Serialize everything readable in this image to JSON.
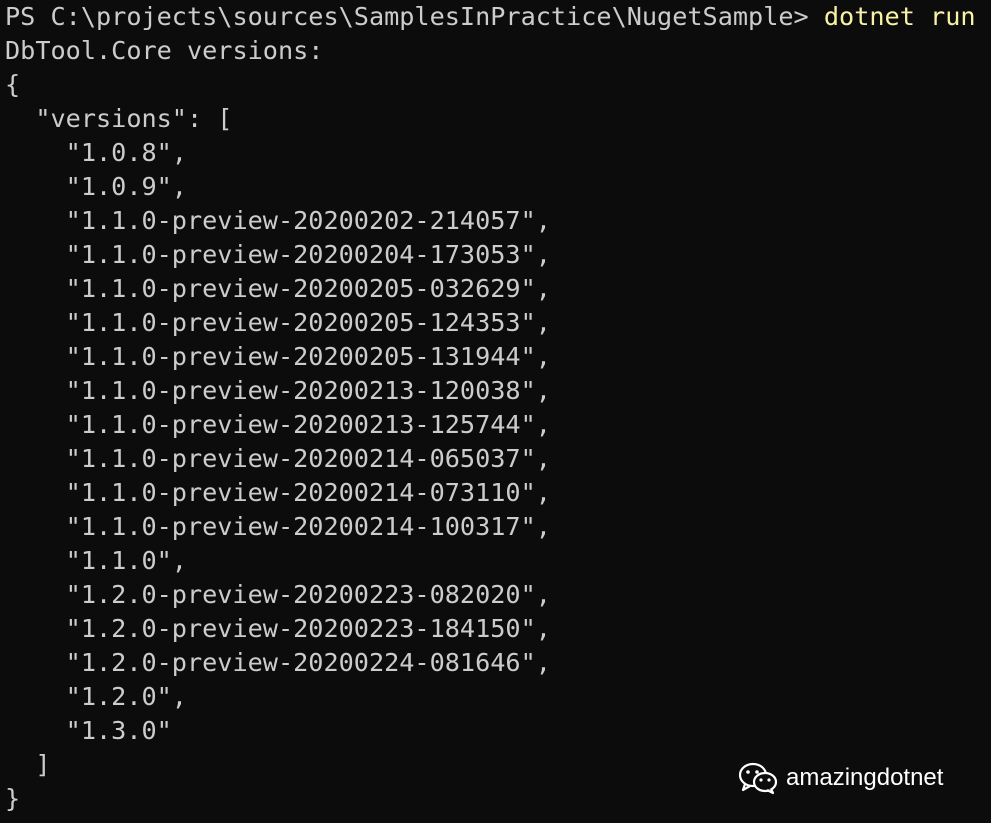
{
  "prompt": {
    "path": "PS C:\\projects\\sources\\SamplesInPractice\\NugetSample> ",
    "command": "dotnet run"
  },
  "output": {
    "heading": "DbTool.Core versions:",
    "open_brace": "{",
    "key_line": "  \"versions\": [",
    "versions": [
      "    \"1.0.8\",",
      "    \"1.0.9\",",
      "    \"1.1.0-preview-20200202-214057\",",
      "    \"1.1.0-preview-20200204-173053\",",
      "    \"1.1.0-preview-20200205-032629\",",
      "    \"1.1.0-preview-20200205-124353\",",
      "    \"1.1.0-preview-20200205-131944\",",
      "    \"1.1.0-preview-20200213-120038\",",
      "    \"1.1.0-preview-20200213-125744\",",
      "    \"1.1.0-preview-20200214-065037\",",
      "    \"1.1.0-preview-20200214-073110\",",
      "    \"1.1.0-preview-20200214-100317\",",
      "    \"1.1.0\",",
      "    \"1.2.0-preview-20200223-082020\",",
      "    \"1.2.0-preview-20200223-184150\",",
      "    \"1.2.0-preview-20200224-081646\",",
      "    \"1.2.0\",",
      "    \"1.3.0\""
    ],
    "close_bracket": "  ]",
    "close_brace": "}"
  },
  "watermark": {
    "text": "amazingdotnet",
    "icon": "wechat-icon"
  },
  "colors": {
    "background": "#0c0c0c",
    "text": "#cccccc",
    "command": "#f9f1a5"
  }
}
